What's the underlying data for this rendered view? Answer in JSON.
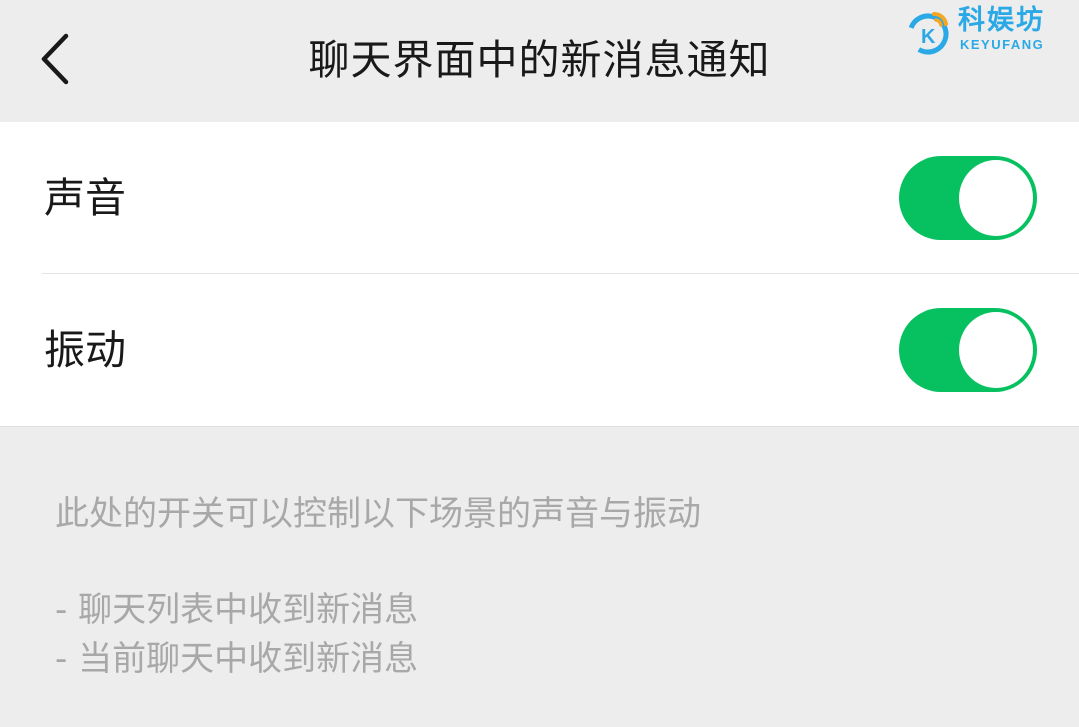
{
  "header": {
    "title": "聊天界面中的新消息通知",
    "back_icon": "chevron-left-icon"
  },
  "watermark": {
    "title": "科娱坊",
    "subtitle": "KEYUFANG",
    "logo_letter": "K",
    "color": "#2aa9e6"
  },
  "settings": [
    {
      "label": "声音",
      "enabled": true
    },
    {
      "label": "振动",
      "enabled": true
    }
  ],
  "description": {
    "main": "此处的开关可以控制以下场景的声音与振动",
    "items": [
      "- 聊天列表中收到新消息",
      "- 当前聊天中收到新消息"
    ]
  },
  "colors": {
    "accent": "#07c160",
    "background": "#ededed",
    "card": "#ffffff",
    "text_primary": "#191919",
    "text_secondary": "#a8a8a8"
  }
}
